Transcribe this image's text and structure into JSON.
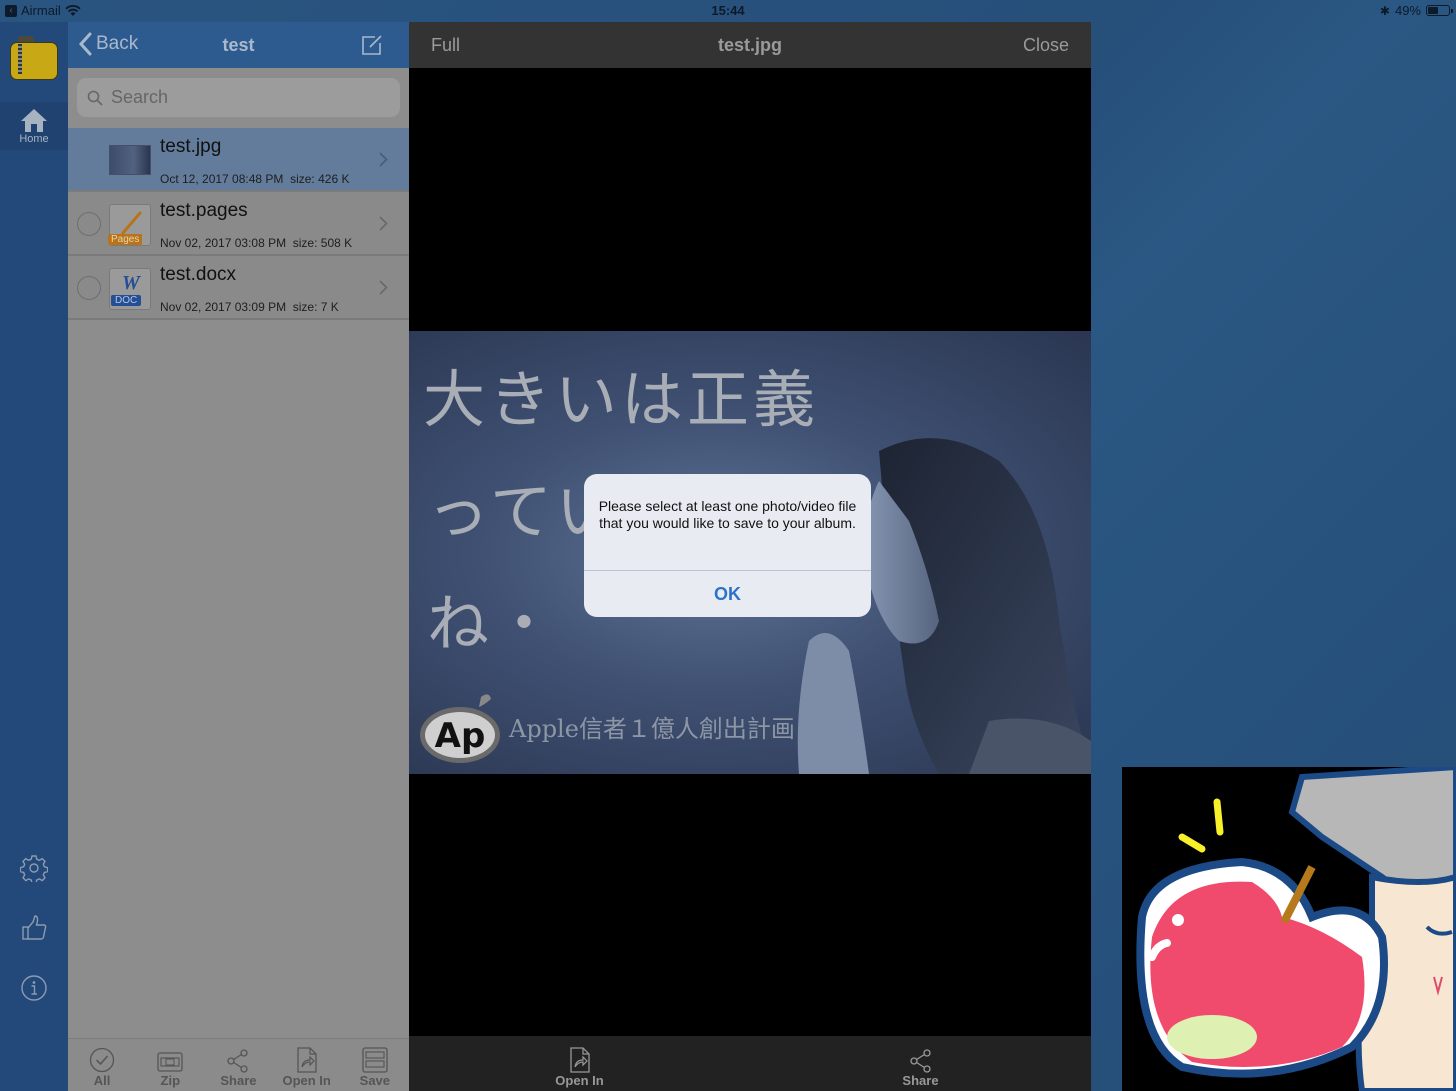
{
  "status_bar": {
    "back_app": "Airmail",
    "time": "15:44",
    "battery_percent": "49%",
    "battery_level": 0.49
  },
  "rail": {
    "home_label": "Home",
    "icons": [
      "settings-icon",
      "thumbs-up-icon",
      "info-icon"
    ]
  },
  "file_panel": {
    "back_label": "Back",
    "title": "test",
    "search_placeholder": "Search",
    "files": [
      {
        "name": "test.jpg",
        "date": "Oct 12, 2017 08:48 PM",
        "size": "size: 426 K",
        "type": "image",
        "selected": true
      },
      {
        "name": "test.pages",
        "date": "Nov 02, 2017 03:08 PM",
        "size": "size: 508 K",
        "type": "pages",
        "badge": "Pages",
        "selected": false
      },
      {
        "name": "test.docx",
        "date": "Nov 02, 2017 03:09 PM",
        "size": "size: 7 K",
        "type": "doc",
        "badge": "DOC",
        "glyph": "W",
        "selected": false
      }
    ],
    "toolbar": {
      "all": "All",
      "zip": "Zip",
      "share": "Share",
      "open_in": "Open In",
      "save": "Save"
    }
  },
  "viewer": {
    "full_label": "Full",
    "title": "test.jpg",
    "close_label": "Close",
    "image_text": {
      "line1": "大きいは正義",
      "line2": "っていうけど",
      "line3": "ね・",
      "logo": "Ap",
      "caption": "Apple信者１億人創出計画"
    },
    "toolbar": {
      "open_in": "Open In",
      "share": "Share"
    }
  },
  "alert": {
    "message": "Please select at least one photo/video file that you would like to save to your album.",
    "ok_label": "OK"
  },
  "colors": {
    "desktop_blue": "#2a5580",
    "header_blue": "#2e5b8f",
    "alert_ok": "#2b73c8",
    "apple_red": "#f04a6c"
  }
}
